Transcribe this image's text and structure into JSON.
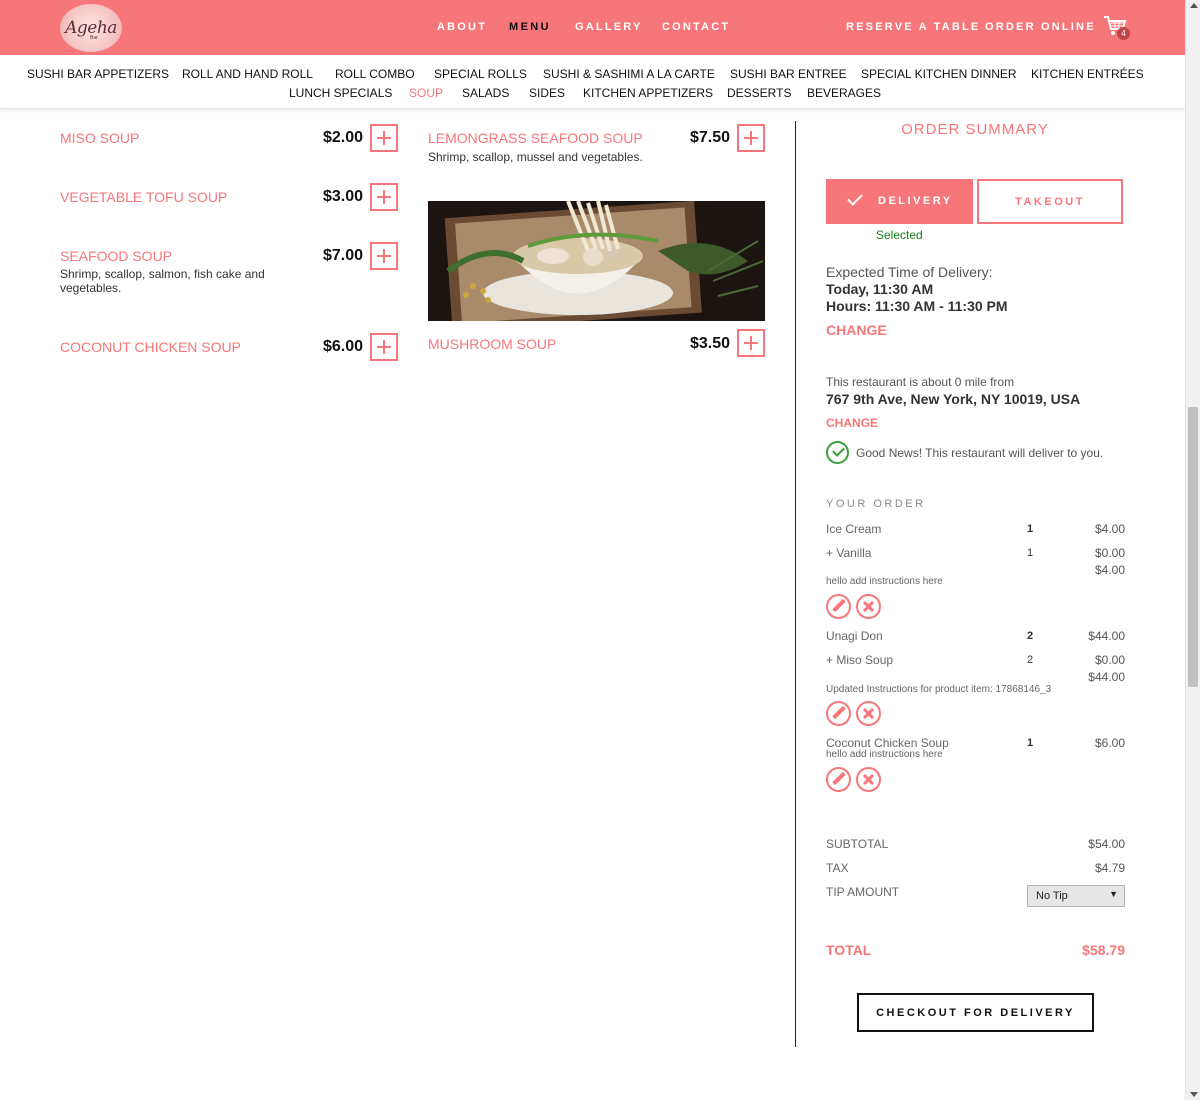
{
  "brand": {
    "logo_text": "Ageha",
    "logo_sub": "Bar"
  },
  "nav": {
    "about": "ABOUT",
    "menu": "MENU",
    "gallery": "GALLERY",
    "contact": "CONTACT",
    "reserve": "RESERVE A TABLE",
    "order_online": "ORDER ONLINE",
    "cart_count": "4"
  },
  "categories": [
    "SUSHI BAR APPETIZERS",
    "ROLL AND HAND ROLL",
    "ROLL COMBO",
    "SPECIAL ROLLS",
    "SUSHI & SASHIMI A LA CARTE",
    "SUSHI BAR ENTREE",
    "SPECIAL KITCHEN DINNER",
    "KITCHEN ENTRÉES",
    "LUNCH SPECIALS",
    "SOUP",
    "SALADS",
    "SIDES",
    "KITCHEN APPETIZERS",
    "DESSERTS",
    "BEVERAGES"
  ],
  "active_category": "SOUP",
  "menu_items": [
    {
      "name": "MISO SOUP",
      "price": "$2.00",
      "desc": ""
    },
    {
      "name": "VEGETABLE TOFU SOUP",
      "price": "$3.00",
      "desc": ""
    },
    {
      "name": "SEAFOOD SOUP",
      "price": "$7.00",
      "desc": "Shrimp, scallop, salmon, fish cake and vegetables."
    },
    {
      "name": "COCONUT CHICKEN SOUP",
      "price": "$6.00",
      "desc": ""
    },
    {
      "name": "LEMONGRASS SEAFOOD SOUP",
      "price": "$7.50",
      "desc": "Shrimp, scallop, mussel and vegetables."
    },
    {
      "name": "MUSHROOM SOUP",
      "price": "$3.50",
      "desc": ""
    }
  ],
  "summary": {
    "title": "ORDER SUMMARY",
    "delivery_label": "DELIVERY",
    "takeout_label": "TAKEOUT",
    "selected_text": "Selected",
    "expected_label": "Expected Time of Delivery:",
    "expected_time": "Today, 11:30 AM",
    "hours": "Hours: 11:30 AM - 11:30 PM",
    "change_label": "CHANGE",
    "distance_text": "This restaurant is about 0 mile from",
    "address": "767 9th Ave, New York, NY 10019, USA",
    "address_change": "CHANGE",
    "good_news": "Good News! This restaurant will deliver to you.",
    "your_order": "YOUR ORDER",
    "orders": [
      {
        "name": "Ice Cream",
        "qty": "1",
        "price": "$4.00",
        "modifier": "+ Vanilla",
        "mod_qty": "1",
        "mod_price": "$0.00",
        "line_total": "$4.00",
        "note": "hello add instructions here"
      },
      {
        "name": "Unagi Don",
        "qty": "2",
        "price": "$44.00",
        "modifier": "+ Miso Soup",
        "mod_qty": "2",
        "mod_price": "$0.00",
        "line_total": "$44.00",
        "note": "Updated Instructions for product item: 17868146_3"
      },
      {
        "name": "Coconut Chicken Soup",
        "qty": "1",
        "price": "$6.00",
        "note": "hello add instructions here"
      }
    ],
    "subtotal_label": "SUBTOTAL",
    "subtotal": "$54.00",
    "tax_label": "TAX",
    "tax": "$4.79",
    "tip_label": "TIP AMOUNT",
    "tip_selected": "No Tip",
    "total_label": "TOTAL",
    "total": "$58.79",
    "checkout_label": "CHECKOUT FOR DELIVERY"
  },
  "colors": {
    "brand": "#f7767a",
    "success": "#3ba03b"
  }
}
